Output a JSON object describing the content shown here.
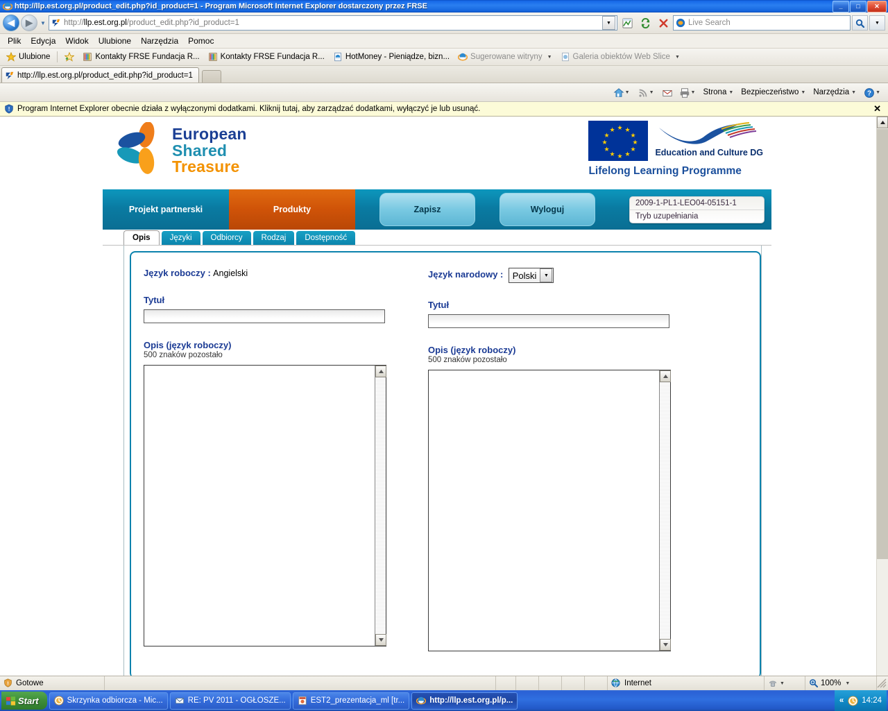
{
  "window": {
    "title": "http://llp.est.org.pl/product_edit.php?id_product=1 - Program Microsoft Internet Explorer dostarczony przez FRSE",
    "minimize": "_",
    "maximize": "□",
    "close": "✕"
  },
  "address_bar": {
    "url_scheme": "http://",
    "url_host": "llp.est.org.pl",
    "url_path": "/product_edit.php?id_product=1",
    "back_glyph": "◀",
    "forward_glyph": "▶",
    "history_caret": "▼",
    "dropdown_caret": "▼",
    "search_placeholder": "Live Search",
    "search_go_glyph": "⌕",
    "search_caret": "▼"
  },
  "menu": {
    "items": [
      "Plik",
      "Edycja",
      "Widok",
      "Ulubione",
      "Narzędzia",
      "Pomoc"
    ]
  },
  "favorites_bar": {
    "label": "Ulubione",
    "items": [
      {
        "label": "Kontakty FRSE  Fundacja R...",
        "dim": false,
        "caret": ""
      },
      {
        "label": "Kontakty FRSE  Fundacja R...",
        "dim": false,
        "caret": ""
      },
      {
        "label": "HotMoney - Pieniądze, bizn...",
        "dim": false,
        "caret": ""
      },
      {
        "label": "Sugerowane witryny",
        "dim": true,
        "caret": "▼"
      },
      {
        "label": "Galeria obiektów Web Slice",
        "dim": true,
        "caret": "▼"
      }
    ]
  },
  "tab_bar": {
    "tab_title": "http://llp.est.org.pl/product_edit.php?id_product=1",
    "new_tab_tooltip": ""
  },
  "command_bar": {
    "items": [
      {
        "label": "",
        "icon": "home-icon",
        "caret": "▼"
      },
      {
        "label": "",
        "icon": "feeds-icon",
        "caret": "▼"
      },
      {
        "label": "",
        "icon": "mail-icon",
        "caret": ""
      },
      {
        "label": "",
        "icon": "print-icon",
        "caret": "▼"
      },
      {
        "label": "Strona",
        "icon": "",
        "caret": "▼"
      },
      {
        "label": "Bezpieczeństwo",
        "icon": "",
        "caret": "▼"
      },
      {
        "label": "Narzędzia",
        "icon": "",
        "caret": "▼"
      },
      {
        "label": "",
        "icon": "help-icon",
        "caret": "▼"
      }
    ]
  },
  "info_bar": {
    "message": "Program Internet Explorer obecnie działa z wyłączonymi dodatkami. Kliknij tutaj, aby zarządzać dodatkami, wyłączyć je lub usunąć.",
    "close": "✕"
  },
  "site": {
    "logo": {
      "line1_cap": "E",
      "line1_rest": "uropean",
      "line2_cap": "S",
      "line2_rest": "hared",
      "line3_cap": "T",
      "line3_rest": "reasure"
    },
    "eu": {
      "dg_text": "Education and Culture DG",
      "programme": "Lifelong Learning Programme"
    },
    "nav": {
      "item_project": "Projekt partnerski",
      "item_products": "Produkty",
      "button_save": "Zapisz",
      "button_logout": "Wyloguj",
      "project_code": "2009-1-PL1-LEO04-05151-1",
      "project_mode": "Tryb uzupełniania"
    },
    "tabs": [
      {
        "label": "Opis",
        "active": true
      },
      {
        "label": "Języki",
        "active": false
      },
      {
        "label": "Odbiorcy",
        "active": false
      },
      {
        "label": "Rodzaj",
        "active": false
      },
      {
        "label": "Dostępność",
        "active": false
      }
    ],
    "form": {
      "left": {
        "lang_label": "Język roboczy :",
        "lang_value": "Angielski",
        "title_label": "Tytuł",
        "title_value": "",
        "desc_label": "Opis (język roboczy)",
        "desc_counter": "500 znaków pozostało",
        "desc_value": ""
      },
      "right": {
        "lang_label": "Język narodowy :",
        "lang_value": "Polski",
        "lang_caret": "▼",
        "title_label": "Tytuł",
        "title_value": "",
        "desc_label": "Opis (język roboczy)",
        "desc_counter": "500 znaków pozostało",
        "desc_value": ""
      }
    }
  },
  "status_bar": {
    "text": "Gotowe",
    "zone": "Internet",
    "zoom": "100%",
    "zoom_caret": "▼",
    "protected_caret": "▼"
  },
  "taskbar": {
    "start": "Start",
    "windows": [
      {
        "label": "Skrzynka odbiorcza - Mic...",
        "icon": "outlook-icon",
        "active": false
      },
      {
        "label": "RE: PV 2011 - OGŁOSZE...",
        "icon": "mail-icon",
        "active": false
      },
      {
        "label": "EST2_prezentacja_ml [tr...",
        "icon": "powerpoint-icon",
        "active": false
      },
      {
        "label": "http://llp.est.org.pl/p...",
        "icon": "ie-icon",
        "active": true
      }
    ],
    "tray_expand": "«",
    "clock": "14:24"
  },
  "colors": {
    "brand_blue": "#1b3f94",
    "brand_teal": "#1f8fb0",
    "brand_orange": "#f39200",
    "nav_teal": "#0a7ba2",
    "nav_active_orange": "#cf5308",
    "label_blue": "#1a3a94"
  }
}
